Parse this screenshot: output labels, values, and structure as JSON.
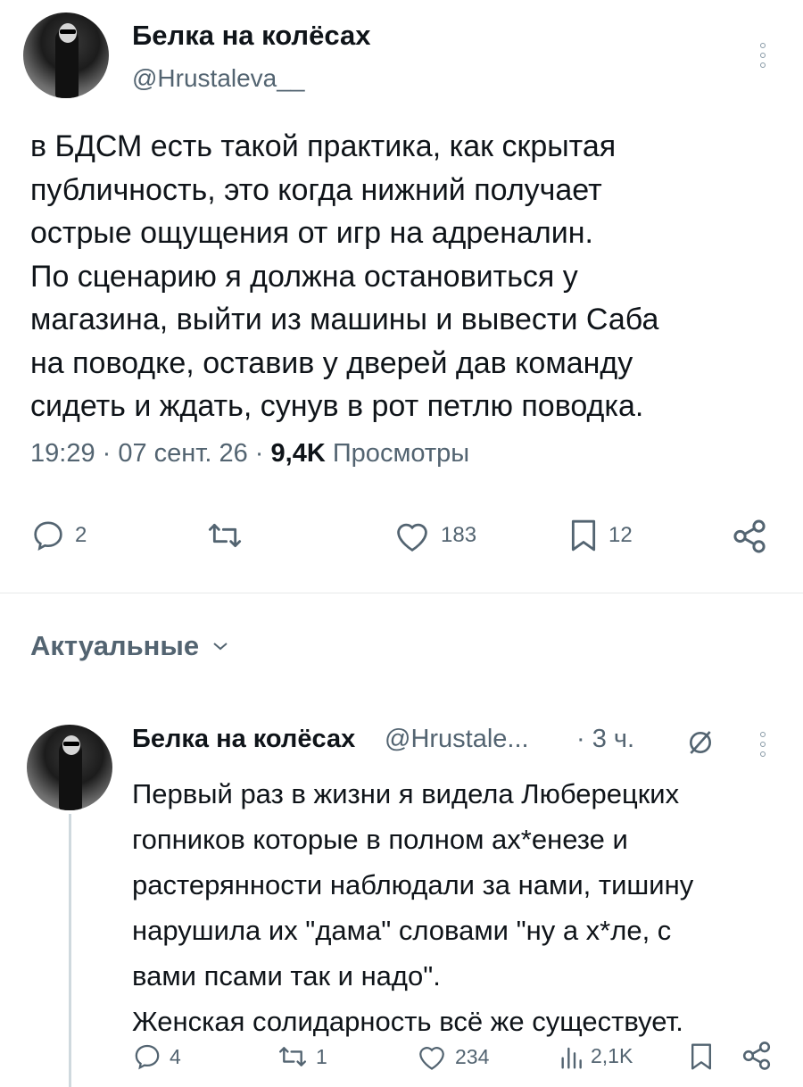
{
  "tweet": {
    "author_name": "Белка на колёсах",
    "author_handle": "@Hrustaleva__",
    "body_lines": [
      "в БДСМ есть такой практика, как скрытая",
      "публичность, это когда нижний получает",
      "острые ощущения от игр на адреналин.",
      "По сценарию я должна остановиться у",
      "магазина, выйти из машины и вывести Саба",
      "на поводке, оставив у дверей дав команду",
      "сидеть и ждать, сунув в рот петлю поводка."
    ],
    "time": "19:29 · 07 сент. 26 · ",
    "views_count": "9,4K",
    "views_label": " Просмотры",
    "actions": {
      "replies": "2",
      "retweets": "",
      "likes": "183",
      "bookmarks": "12"
    }
  },
  "sort": {
    "label": "Актуальные"
  },
  "reply": {
    "author_name": "Белка на колёсах",
    "author_handle": "@Hrustale...",
    "time": "· 3 ч.",
    "body_lines": [
      "Первый раз в жизни я видела Люберецких",
      "гопников которые в полном ах*енезе и",
      "растерянности наблюдали за нами, тишину",
      "нарушила их \"дама\" словами \"ну а х*ле, с",
      "вами псами так и надо\".",
      "Женская солидарность всё же существует."
    ],
    "actions": {
      "replies": "4",
      "retweets": "1",
      "likes": "234",
      "views": "2,1K"
    }
  },
  "colors": {
    "text": "#0f1419",
    "secondary": "#536471",
    "divider": "#e7e9ea"
  }
}
